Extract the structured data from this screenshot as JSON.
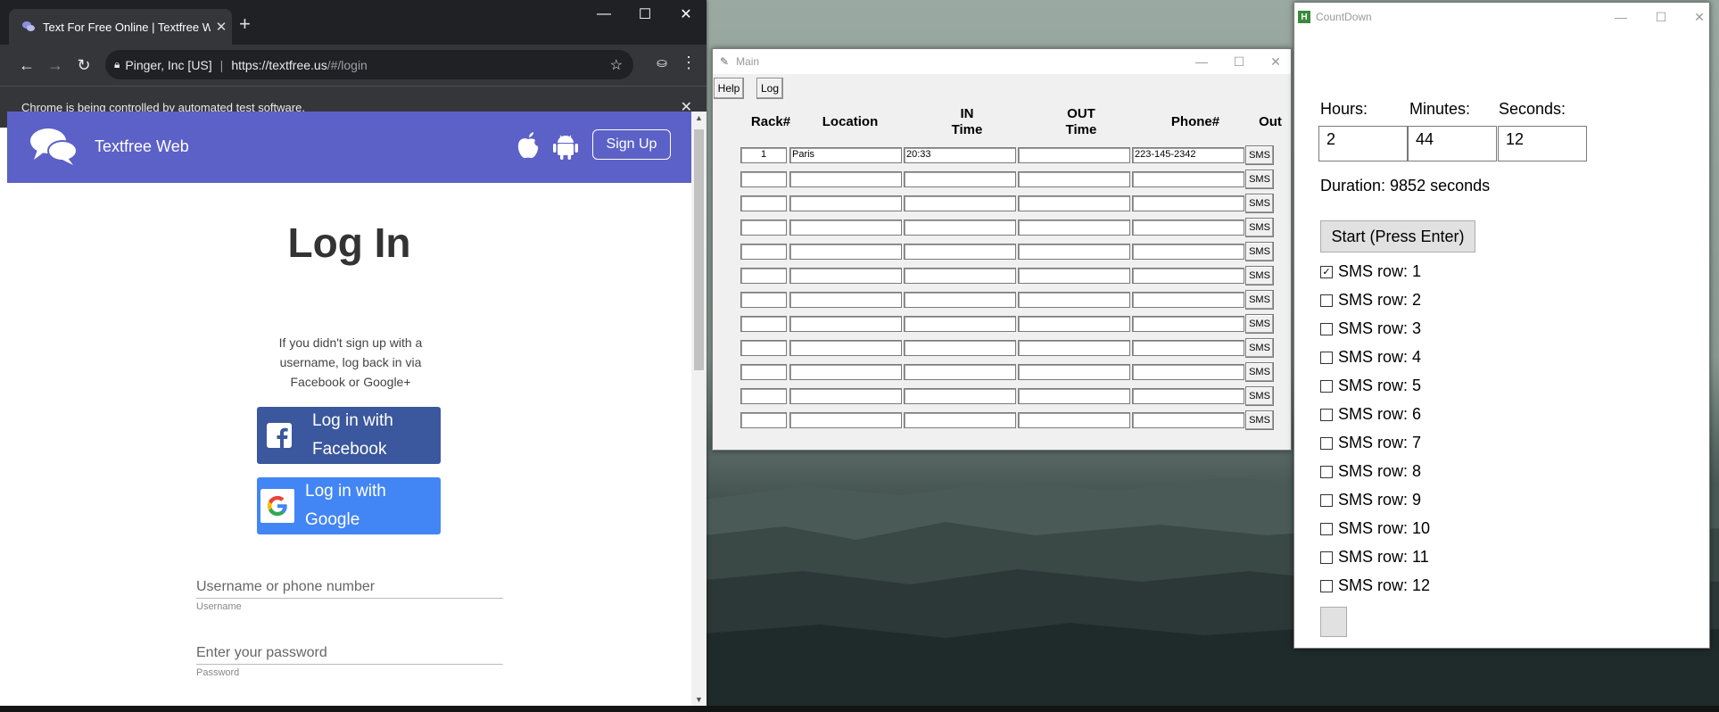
{
  "chrome": {
    "tab_title": "Text For Free Online | Textfree Web",
    "tab_title_shown": "Text For Free Online | Textfree W",
    "omnibox": {
      "site_identity": "Pinger, Inc [US]",
      "url_host": "https://textfree.us",
      "url_path": "/#/login"
    },
    "infobar_text": "Chrome is being controlled by automated test software."
  },
  "textfree": {
    "brand": "Textfree Web",
    "signup_label": "Sign Up",
    "heading": "Log In",
    "note": "If you didn't sign up with a username, log back in via Facebook or Google+",
    "facebook_line1": "Log in with",
    "facebook_line2": "Facebook",
    "google_line1": "Log in with",
    "google_line2": "Google",
    "username_placeholder": "Username or phone number",
    "username_caption": "Username",
    "password_placeholder": "Enter your password",
    "password_caption": "Password",
    "brand_color": "#5c61c7",
    "facebook_color": "#3b579d",
    "google_color": "#4285f4"
  },
  "main_window": {
    "title": "Main",
    "menu": {
      "help_label": "Help",
      "log_label": "Log"
    },
    "headers": {
      "rack": "Rack#",
      "location": "Location",
      "in_line1": "IN",
      "in_line2": "Time",
      "out_line1": "OUT",
      "out_line2": "Time",
      "phone": "Phone#",
      "out": "Out"
    },
    "sms_label": "SMS",
    "rows": [
      {
        "rack": "1",
        "location": "Paris",
        "in_time": "20:33",
        "out_time": "",
        "phone": "223-145-2342"
      },
      {
        "rack": "",
        "location": "",
        "in_time": "",
        "out_time": "",
        "phone": ""
      },
      {
        "rack": "",
        "location": "",
        "in_time": "",
        "out_time": "",
        "phone": ""
      },
      {
        "rack": "",
        "location": "",
        "in_time": "",
        "out_time": "",
        "phone": ""
      },
      {
        "rack": "",
        "location": "",
        "in_time": "",
        "out_time": "",
        "phone": ""
      },
      {
        "rack": "",
        "location": "",
        "in_time": "",
        "out_time": "",
        "phone": ""
      },
      {
        "rack": "",
        "location": "",
        "in_time": "",
        "out_time": "",
        "phone": ""
      },
      {
        "rack": "",
        "location": "",
        "in_time": "",
        "out_time": "",
        "phone": ""
      },
      {
        "rack": "",
        "location": "",
        "in_time": "",
        "out_time": "",
        "phone": ""
      },
      {
        "rack": "",
        "location": "",
        "in_time": "",
        "out_time": "",
        "phone": ""
      },
      {
        "rack": "",
        "location": "",
        "in_time": "",
        "out_time": "",
        "phone": ""
      },
      {
        "rack": "",
        "location": "",
        "in_time": "",
        "out_time": "",
        "phone": ""
      }
    ]
  },
  "countdown": {
    "title": "CountDown",
    "hours_label": "Hours:",
    "minutes_label": "Minutes:",
    "seconds_label": "Seconds:",
    "hours_value": "2",
    "minutes_value": "44",
    "seconds_value": "12",
    "duration_text": "Duration: 9852 seconds",
    "start_label": "Start (Press Enter)",
    "sms_rows": [
      {
        "label": "SMS row: 1",
        "checked": true
      },
      {
        "label": "SMS row: 2",
        "checked": false
      },
      {
        "label": "SMS row: 3",
        "checked": false
      },
      {
        "label": "SMS row: 4",
        "checked": false
      },
      {
        "label": "SMS row: 5",
        "checked": false
      },
      {
        "label": "SMS row: 6",
        "checked": false
      },
      {
        "label": "SMS row: 7",
        "checked": false
      },
      {
        "label": "SMS row: 8",
        "checked": false
      },
      {
        "label": "SMS row: 9",
        "checked": false
      },
      {
        "label": "SMS row: 10",
        "checked": false
      },
      {
        "label": "SMS row: 11",
        "checked": false
      },
      {
        "label": "SMS row: 12",
        "checked": false
      }
    ]
  }
}
